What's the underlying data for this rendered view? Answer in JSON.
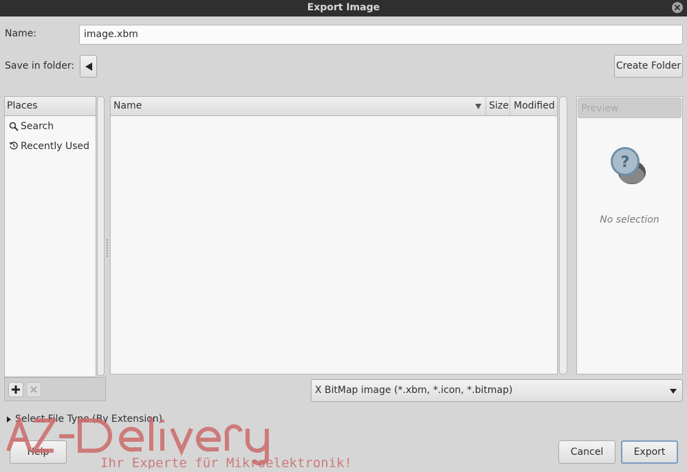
{
  "window": {
    "title": "Export Image"
  },
  "name_label": "Name:",
  "name_value": "image.xbm",
  "folder_label": "Save in folder:",
  "create_folder": "Create Folder",
  "places": {
    "header": "Places",
    "items": [
      {
        "label": "Search",
        "icon": "search-icon"
      },
      {
        "label": "Recently Used",
        "icon": "recent-icon"
      }
    ]
  },
  "files": {
    "col_name": "Name",
    "col_size": "Size",
    "col_modified": "Modified"
  },
  "preview": {
    "header": "Preview",
    "empty_text": "No selection"
  },
  "file_type": "X BitMap image (*.xbm, *.icon, *.bitmap)",
  "select_file_type": "Select File Type (By Extension)",
  "buttons": {
    "help": "Help",
    "cancel": "Cancel",
    "export": "Export"
  },
  "watermark": {
    "brand": "AZ-Delivery",
    "tagline": "Ihr Experte für Mikroelektronik!"
  }
}
